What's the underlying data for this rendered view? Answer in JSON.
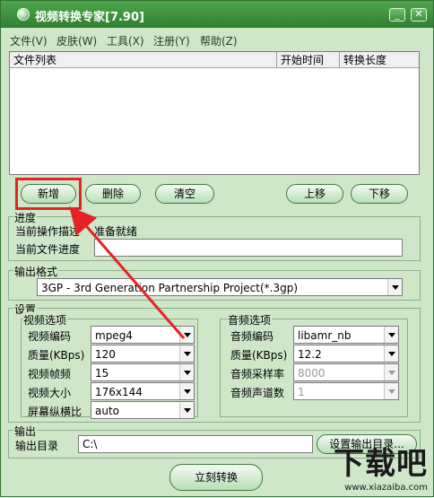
{
  "window": {
    "title": "视频转换专家[7.90]",
    "min_icon": "minimize-icon",
    "close_icon": "close-icon"
  },
  "menu": [
    "文件(V)",
    "皮肤(W)",
    "工具(X)",
    "注册(Y)",
    "帮助(Z)"
  ],
  "file_list": {
    "columns": [
      "文件列表",
      "开始时间",
      "转换长度"
    ]
  },
  "buttons": {
    "add": "新增",
    "delete": "删除",
    "clear": "清空",
    "up": "上移",
    "down": "下移",
    "set_output": "设置输出目录...",
    "convert": "立刻转换"
  },
  "progress": {
    "title": "进度",
    "current_op_label": "当前操作描述",
    "current_op_value": "准备就绪",
    "current_file_label": "当前文件进度"
  },
  "output_format": {
    "title": "输出格式",
    "value": "3GP - 3rd Generation Partnership Project(*.3gp)"
  },
  "settings": {
    "title": "设置",
    "video": {
      "title": "视频选项",
      "rows": [
        {
          "label": "视频编码",
          "value": "mpeg4"
        },
        {
          "label": "质量(KBps)",
          "value": "120"
        },
        {
          "label": "视频帧频",
          "value": "15"
        },
        {
          "label": "视频大小",
          "value": "176x144"
        },
        {
          "label": "屏幕纵横比",
          "value": "auto"
        }
      ]
    },
    "audio": {
      "title": "音频选项",
      "rows": [
        {
          "label": "音频编码",
          "value": "libamr_nb"
        },
        {
          "label": "质量(KBps)",
          "value": "12.2"
        },
        {
          "label": "音频采样率",
          "value": "8000"
        },
        {
          "label": "音频声道数",
          "value": "1"
        }
      ]
    }
  },
  "output": {
    "title": "输出",
    "dir_label": "输出目录",
    "dir_value": "C:\\"
  },
  "annotation": {
    "color": "#e22424"
  },
  "watermark": {
    "big": "下载吧",
    "small": "www.xiazaiba.com"
  }
}
